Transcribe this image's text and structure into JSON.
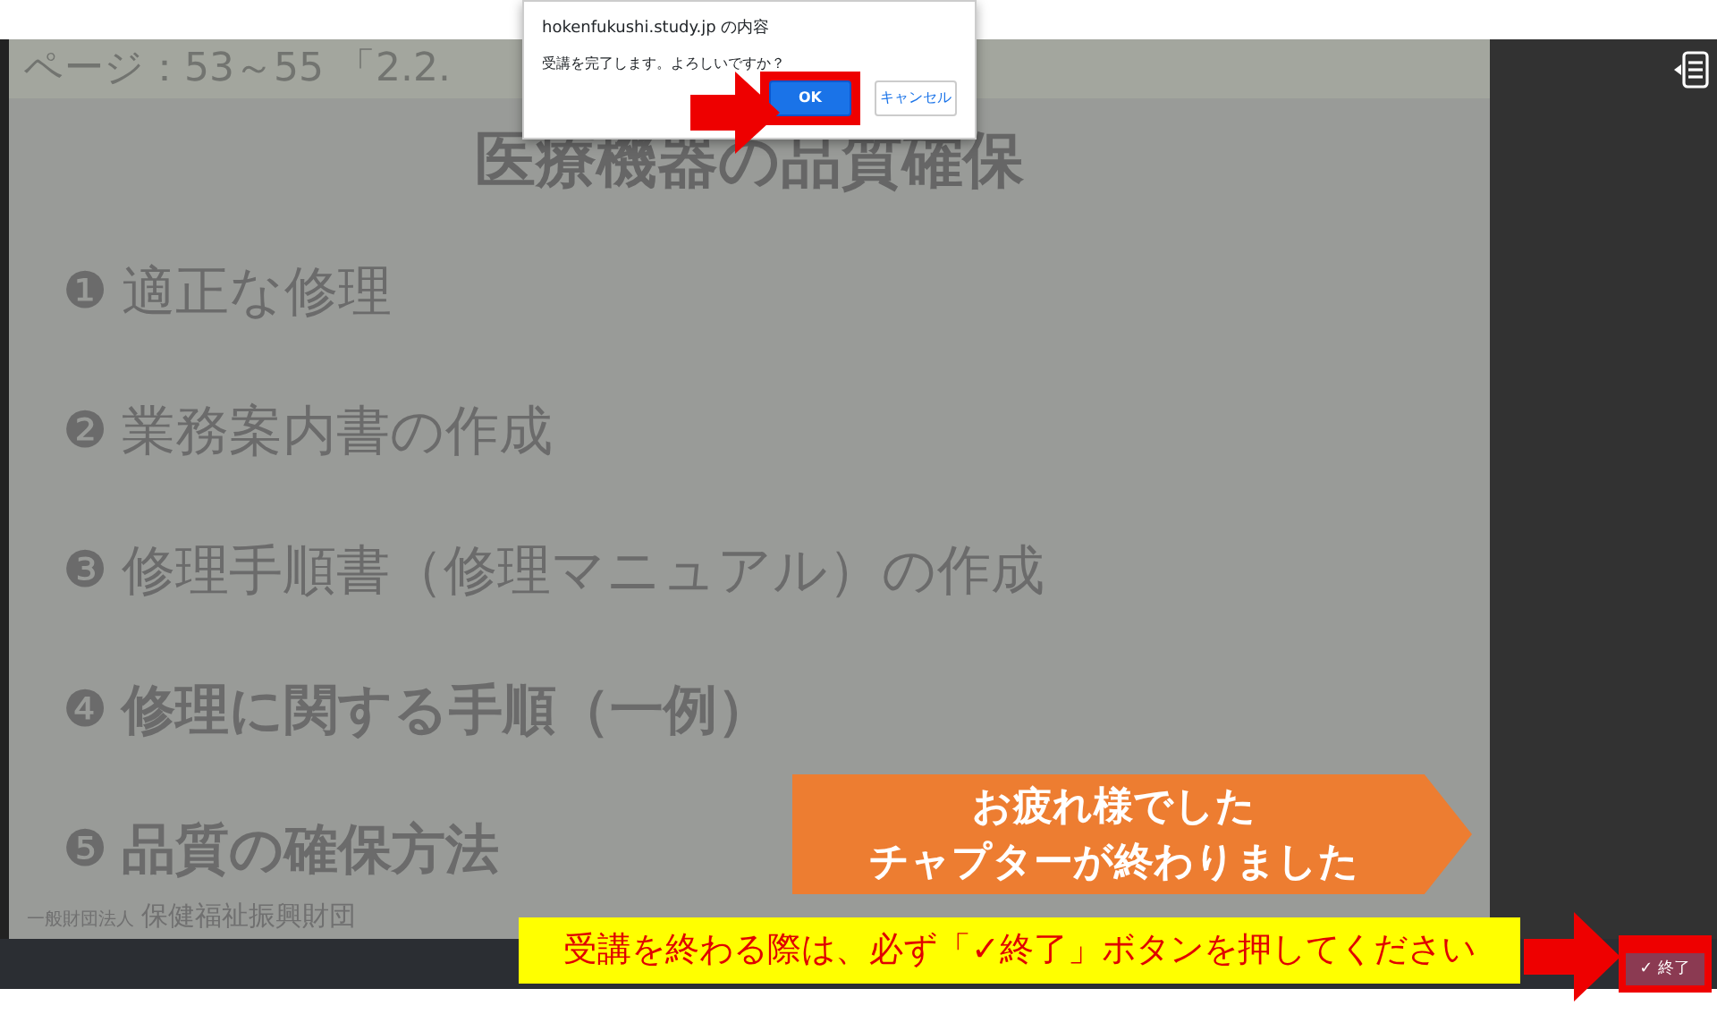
{
  "dialog": {
    "title": "hokenfukushi.study.jp の内容",
    "message": "受講を完了します。よろしいですか？",
    "buttons": [
      {
        "label": "OK",
        "selected": true
      },
      {
        "label": "キャンセル",
        "selected": false
      }
    ]
  },
  "slide": {
    "header": "ページ：53～55 「2.2.",
    "title": "医療機器の品質確保",
    "items": [
      {
        "number": "❶",
        "text": "適正な修理",
        "bold": false
      },
      {
        "number": "❷",
        "text": "業務案内書の作成",
        "bold": false
      },
      {
        "number": "❸",
        "text": "修理手順書（修理マニュアル）の作成",
        "bold": false
      },
      {
        "number": "❹",
        "text": "修理に関する手順（一例）",
        "bold": true
      },
      {
        "number": "❺",
        "text": "品質の確保方法",
        "bold": true
      }
    ],
    "footer": {
      "org_type": "一般財団法人",
      "org_name": "保健福祉振興財団"
    },
    "banner": {
      "lines": [
        "お疲れ様でした",
        "チャプターが終わりました"
      ]
    }
  },
  "end_button": {
    "label": "✓ 終了"
  },
  "callout": {
    "text": "受講を終わる際は、必ず「✓終了」ボタンを押してください"
  }
}
